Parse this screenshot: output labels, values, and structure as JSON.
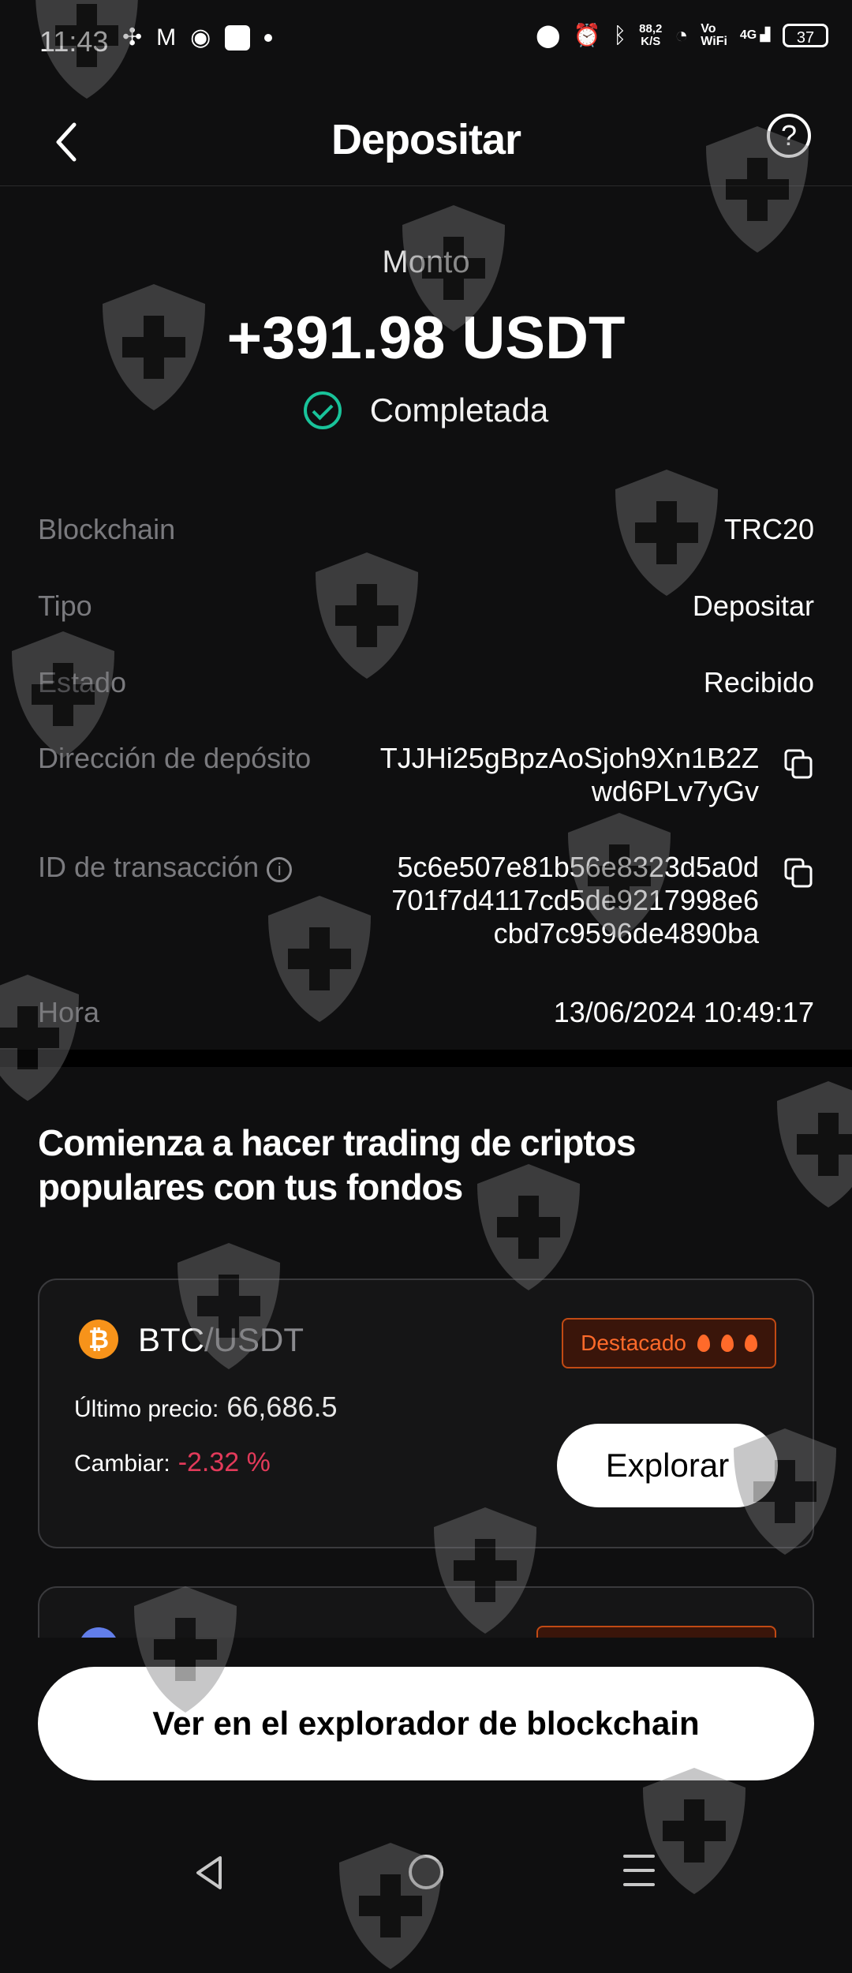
{
  "status_bar": {
    "time": "11:43",
    "speed_top": "88,2",
    "speed_bottom": "K/S",
    "vo": "Vo",
    "wifi": "WiFi",
    "network": "4G",
    "battery": "37"
  },
  "header": {
    "title": "Depositar",
    "back_icon": "chevron-left-icon",
    "help_icon": "question-circle-icon",
    "help_glyph": "?"
  },
  "summary": {
    "amount_label": "Monto",
    "amount": "+391.98 USDT",
    "status": "Completada",
    "status_color": "#19c39a"
  },
  "details": {
    "blockchain_label": "Blockchain",
    "blockchain_value": "TRC20",
    "type_label": "Tipo",
    "type_value": "Depositar",
    "state_label": "Estado",
    "state_value": "Recibido",
    "address_label": "Dirección de depósito",
    "address_line1": "TJJHi25gBpzAoSjoh9Xn1B2Z",
    "address_line2": "wd6PLv7yGv",
    "txid_label": "ID de transacción",
    "txid_info_glyph": "i",
    "txid_line1": "5c6e507e81b56e8323d5a0d",
    "txid_line2": "701f7d4117cd5de9217998e6",
    "txid_line3": "cbd7c9596de4890ba",
    "time_label": "Hora",
    "time_value": "13/06/2024 10:49:17"
  },
  "promo": {
    "title_line1": "Comienza a hacer trading de criptos",
    "title_line2": "populares con tus fondos",
    "card1": {
      "coin_glyph": "₿",
      "base": "BTC",
      "quote": "/USDT",
      "badge": "Destacado",
      "price_label": "Último precio:",
      "price": "66,686.5",
      "change_label": "Cambiar:",
      "change": "-2.32 %",
      "change_color": "#e23a5a",
      "explore": "Explorar"
    }
  },
  "footer": {
    "explorer_button": "Ver en el explorador de blockchain"
  },
  "colors": {
    "background": "#0f0f10",
    "success": "#19c39a",
    "badge_orange": "#ff6a2a",
    "negative": "#e23a5a"
  }
}
